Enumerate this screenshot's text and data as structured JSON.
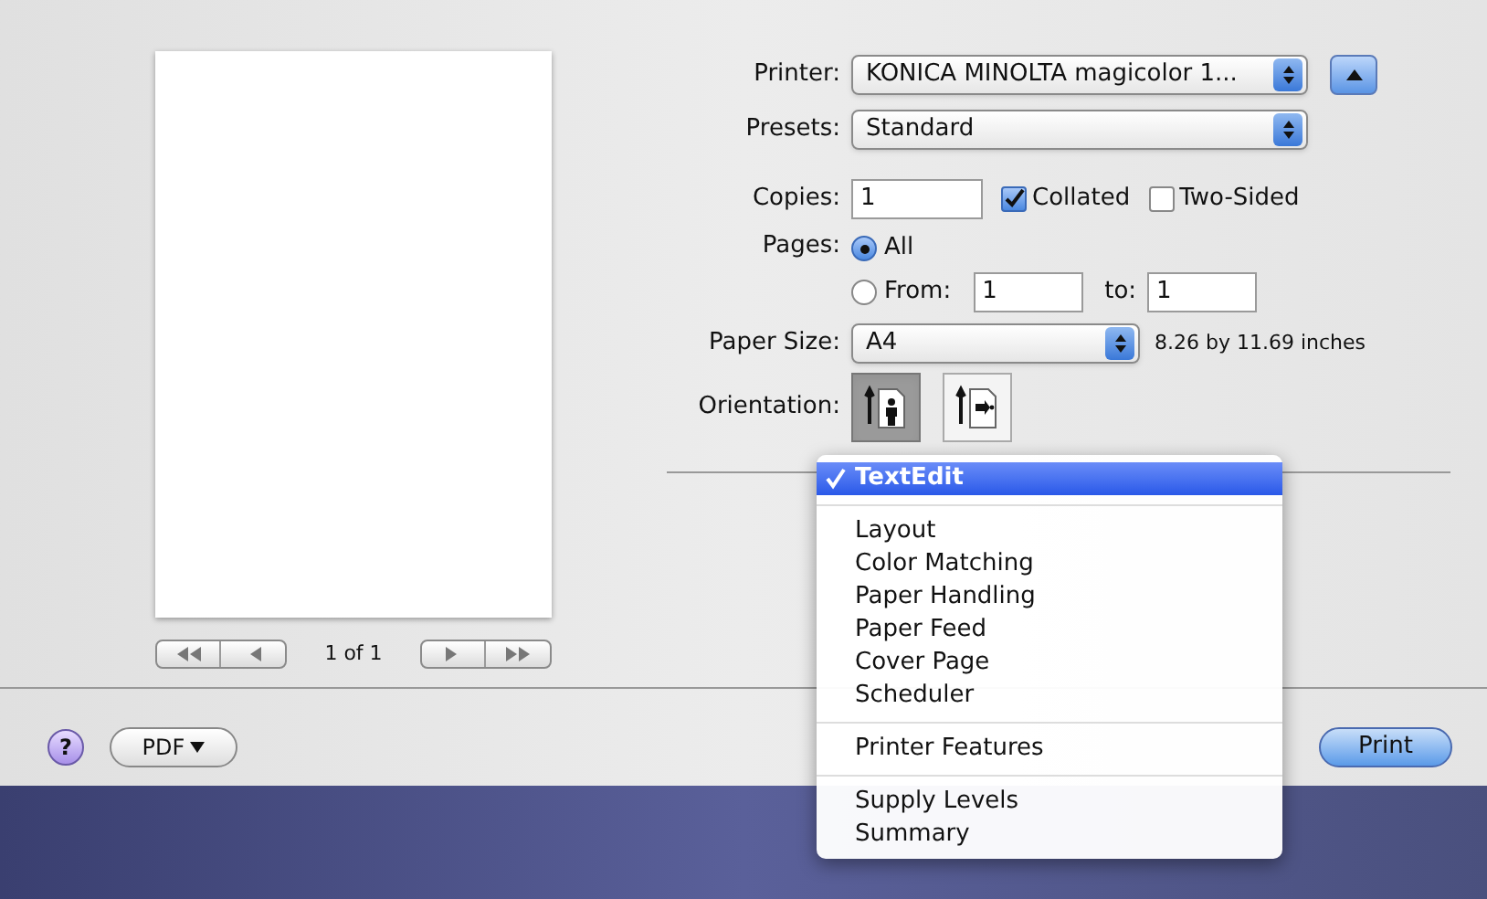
{
  "printer": {
    "label": "Printer:",
    "value": "KONICA MINOLTA magicolor 1..."
  },
  "presets": {
    "label": "Presets:",
    "value": "Standard"
  },
  "copies": {
    "label": "Copies:",
    "value": "1"
  },
  "collated": {
    "label": "Collated",
    "checked": true
  },
  "two_sided": {
    "label": "Two-Sided",
    "checked": false
  },
  "pages": {
    "label": "Pages:",
    "options": [
      {
        "label": "All",
        "selected": true
      },
      {
        "label": "From:",
        "selected": false
      }
    ],
    "from": "1",
    "to_label": "to:",
    "to": "1"
  },
  "paper_size": {
    "label": "Paper Size:",
    "value": "A4",
    "dimensions": "8.26 by 11.69 inches"
  },
  "orientation": {
    "label": "Orientation:",
    "options": [
      {
        "kind": "portrait",
        "selected": true
      },
      {
        "kind": "landscape",
        "selected": false
      }
    ]
  },
  "preview": {
    "page_count": "1 of 1"
  },
  "menu": {
    "groups": [
      [
        {
          "label": "TextEdit",
          "selected": true
        }
      ],
      [
        {
          "label": "Layout",
          "selected": false
        },
        {
          "label": "Color Matching",
          "selected": false
        },
        {
          "label": "Paper Handling",
          "selected": false
        },
        {
          "label": "Paper Feed",
          "selected": false
        },
        {
          "label": "Cover Page",
          "selected": false
        },
        {
          "label": "Scheduler",
          "selected": false
        }
      ],
      [
        {
          "label": "Printer Features",
          "selected": false
        }
      ],
      [
        {
          "label": "Supply Levels",
          "selected": false
        },
        {
          "label": "Summary",
          "selected": false
        }
      ]
    ]
  },
  "buttons": {
    "help": "?",
    "pdf": "PDF",
    "print": "Print"
  }
}
